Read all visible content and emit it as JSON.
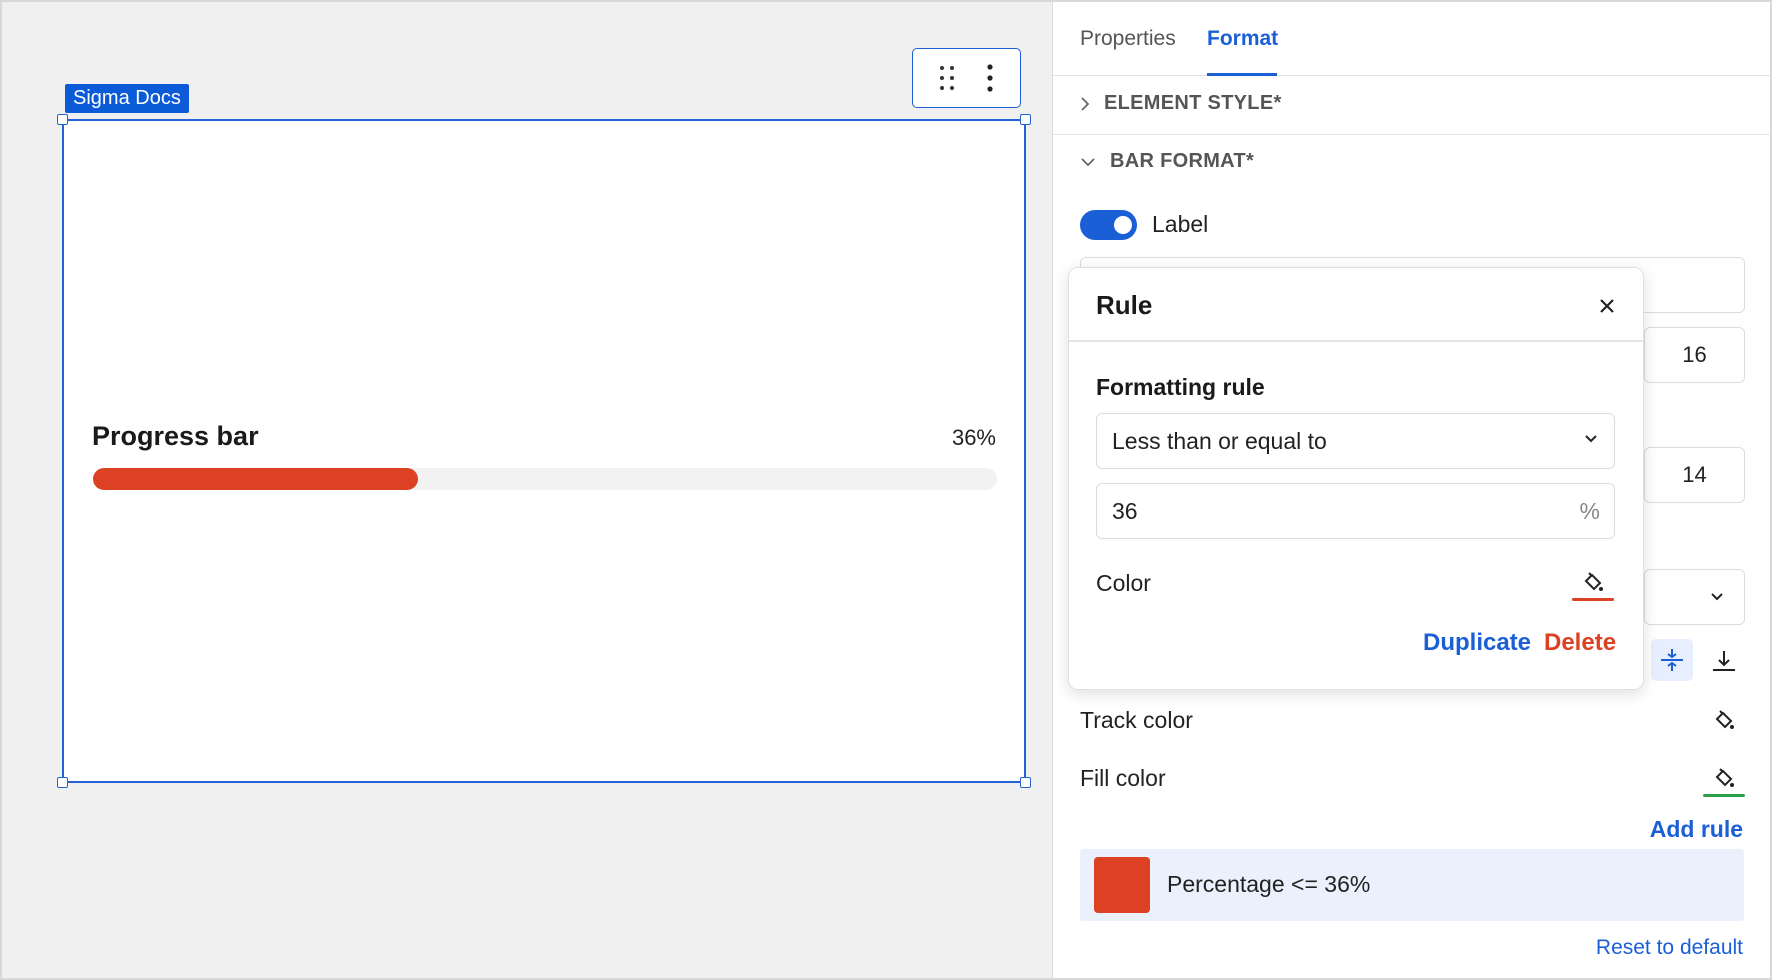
{
  "canvas": {
    "element_tag": "Sigma Docs",
    "progress_bar": {
      "title": "Progress bar",
      "value_label": "36%",
      "progress": 0.36,
      "fill_color": "#dd4123",
      "track_color": "#f2f2f2"
    }
  },
  "panel": {
    "tabs": [
      "Properties",
      "Format"
    ],
    "active_tab": "Format",
    "sections": {
      "element_style": "ELEMENT STYLE*",
      "bar_format": "BAR FORMAT*"
    },
    "label_toggle": {
      "label": "Label",
      "on": true
    },
    "fields": {
      "size_a": "16",
      "size_b": "14"
    },
    "track_color_label": "Track color",
    "fill_color_label": "Fill color",
    "add_rule": "Add rule",
    "rule_item": {
      "text": "Percentage <= 36%",
      "color": "#dd4123"
    },
    "reset": "Reset to default"
  },
  "popover": {
    "title": "Rule",
    "subtitle": "Formatting rule",
    "condition": "Less than or equal to",
    "value": "36",
    "unit": "%",
    "color_label": "Color",
    "color": "#dd4123",
    "duplicate": "Duplicate",
    "delete": "Delete"
  }
}
